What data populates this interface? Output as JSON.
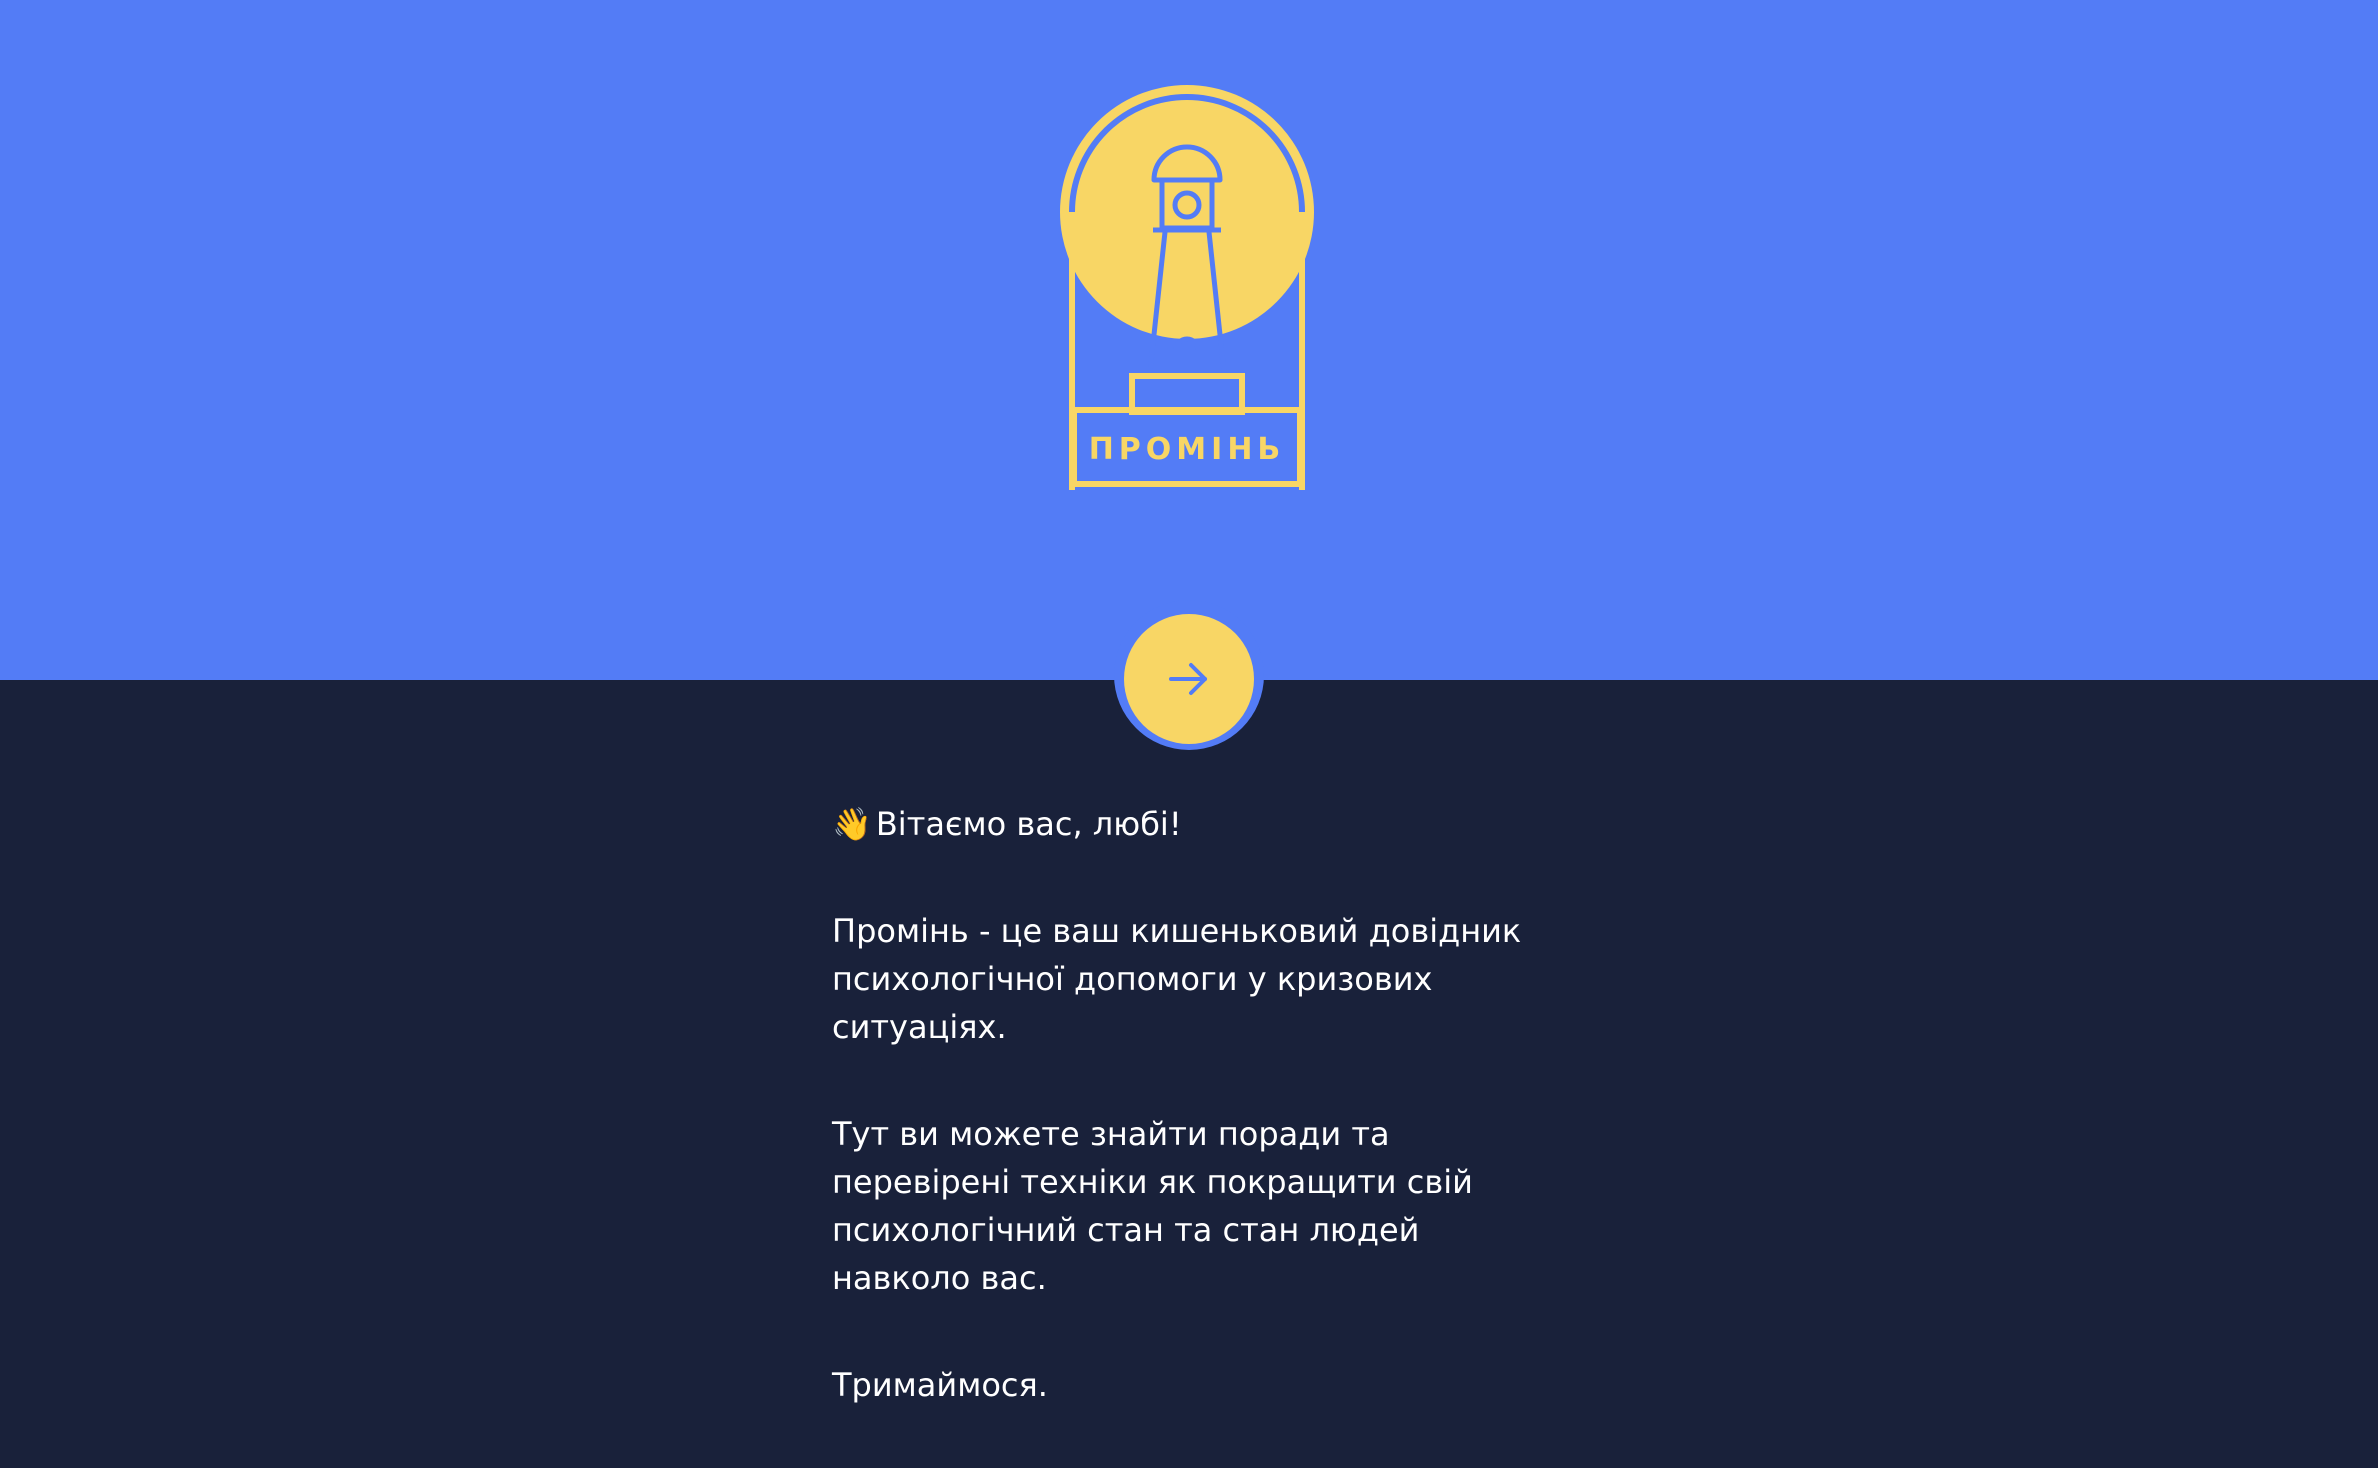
{
  "colors": {
    "hero_bg": "#537cf6",
    "content_bg": "#19213a",
    "accent": "#f8d665",
    "text": "#ffffff"
  },
  "logo": {
    "label": "ПРОМІНЬ",
    "icon": "lighthouse-icon"
  },
  "next_button": {
    "icon": "arrow-right-icon"
  },
  "welcome": {
    "greeting_emoji": "👋",
    "greeting": "Вітаємо вас, любі!",
    "paragraph_1": "Промінь - це ваш кишеньковий довідник психологічної допомоги у кризових ситуаціях.",
    "paragraph_2": "Тут ви можете знайти поради та перевірені техніки як покращити свій психологічний стан та стан людей навколо вас.",
    "paragraph_3": "Тримаймося."
  }
}
